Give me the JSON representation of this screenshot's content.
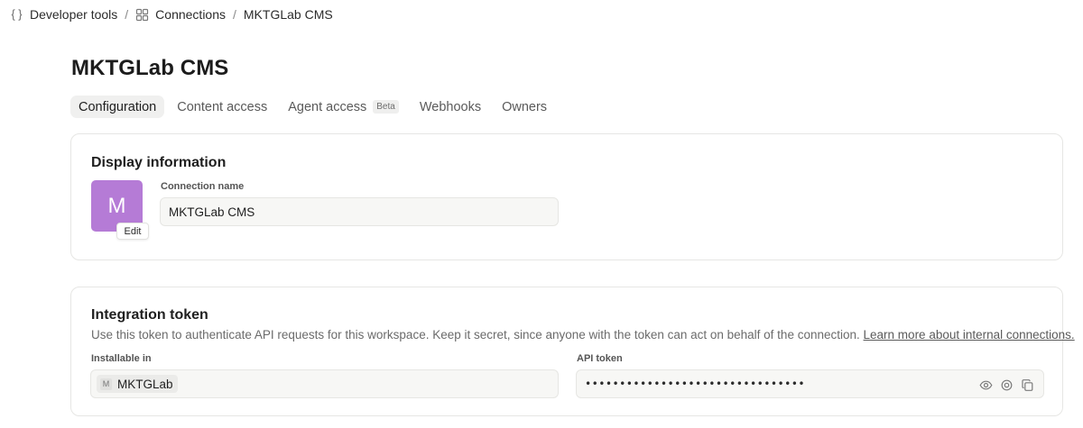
{
  "breadcrumb": [
    {
      "label": "Developer tools",
      "icon": "braces-icon"
    },
    {
      "label": "Connections",
      "icon": "grid-icon"
    },
    {
      "label": "MKTGLab CMS"
    }
  ],
  "breadcrumb_separator": "/",
  "page_title": "MKTGLab CMS",
  "tabs": [
    {
      "label": "Configuration",
      "active": true
    },
    {
      "label": "Content access"
    },
    {
      "label": "Agent access",
      "badge": "Beta"
    },
    {
      "label": "Webhooks"
    },
    {
      "label": "Owners"
    }
  ],
  "display_info": {
    "title": "Display information",
    "avatar_letter": "M",
    "avatar_color": "#b57bd6",
    "edit_label": "Edit",
    "connection_name_label": "Connection name",
    "connection_name_value": "MKTGLab CMS"
  },
  "integration_token": {
    "title": "Integration token",
    "description": "Use this token to authenticate API requests for this workspace. Keep it secret, since anyone with the token can act on behalf of the connection.",
    "learn_more": "Learn more about internal connections.",
    "installable_label": "Installable in",
    "workspace_initial": "M",
    "workspace_name": "MKTGLab",
    "api_token_label": "API token",
    "api_token_masked": "••••••••••••••••••••••••••••••••",
    "actions": [
      "eye-icon",
      "regenerate-icon",
      "copy-icon"
    ]
  }
}
